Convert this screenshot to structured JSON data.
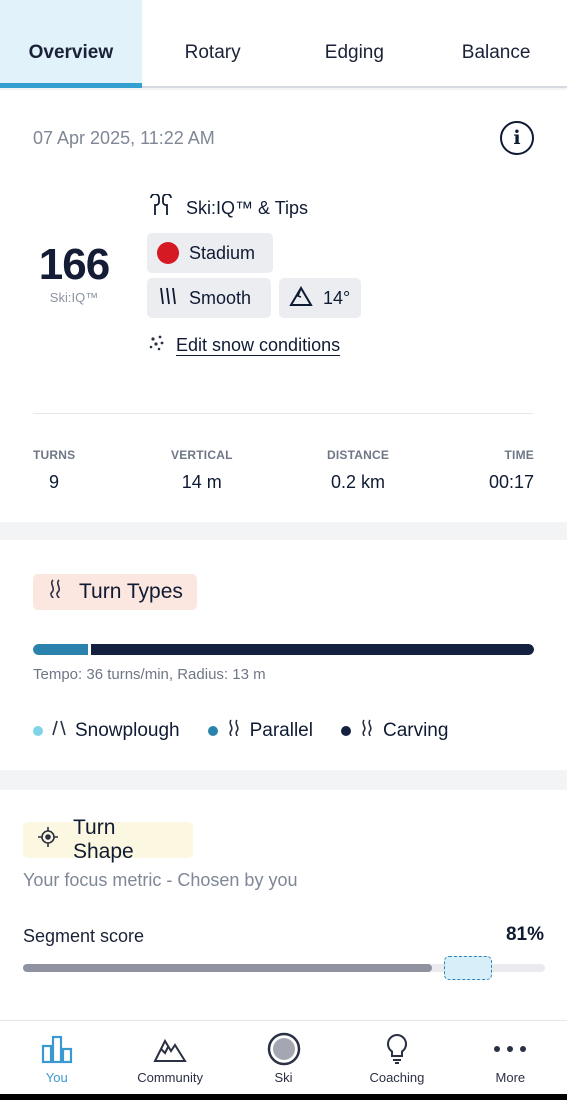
{
  "tabs": [
    {
      "label": "Overview",
      "active": true
    },
    {
      "label": "Rotary",
      "active": false
    },
    {
      "label": "Edging",
      "active": false
    },
    {
      "label": "Balance",
      "active": false
    }
  ],
  "summary": {
    "date": "07 Apr 2025, 11:22 AM",
    "score": "166",
    "score_label": "Ski:IQ™",
    "tips_label": "Ski:IQ™ & Tips",
    "run_type": "Stadium",
    "run_color": "#d51a24",
    "snow": "Smooth",
    "slope": "14°",
    "edit_label": "Edit snow conditions",
    "stats": [
      {
        "label": "TURNS",
        "value": "9"
      },
      {
        "label": "VERTICAL",
        "value": "14 m"
      },
      {
        "label": "DISTANCE",
        "value": "0.2 km"
      },
      {
        "label": "TIME",
        "value": "00:17"
      }
    ]
  },
  "turn_types": {
    "title": "Turn Types",
    "snowplough_fraction": 0.0,
    "parallel_fraction": 0.11,
    "carving_fraction": 0.89,
    "tempo": "Tempo: 36 turns/min, Radius: 13 m",
    "legend": [
      {
        "label": "Snowplough",
        "color": "#7fd4ea"
      },
      {
        "label": "Parallel",
        "color": "#2a82ad"
      },
      {
        "label": "Carving",
        "color": "#13203f"
      }
    ]
  },
  "turn_shape": {
    "title": "Turn Shape",
    "subtitle": "Your focus metric - Chosen by you",
    "segment_label": "Segment score",
    "segment_value": "81%",
    "segment_fraction": 0.81
  },
  "nav": [
    {
      "label": "You",
      "icon": "chart-bars-icon",
      "active": true
    },
    {
      "label": "Community",
      "icon": "mountains-icon",
      "active": false
    },
    {
      "label": "Ski",
      "icon": "record-circle-icon",
      "active": false
    },
    {
      "label": "Coaching",
      "icon": "lightbulb-icon",
      "active": false
    },
    {
      "label": "More",
      "icon": "more-dots-icon",
      "active": false
    }
  ]
}
